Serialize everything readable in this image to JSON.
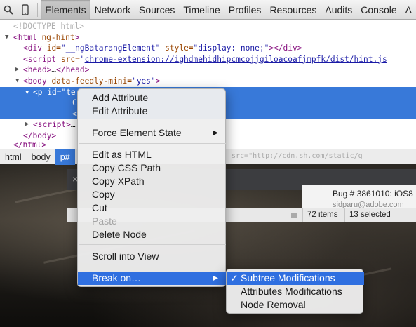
{
  "toolbar": {
    "tabs": [
      {
        "label": "Elements",
        "active": true
      },
      {
        "label": "Network"
      },
      {
        "label": "Sources"
      },
      {
        "label": "Timeline"
      },
      {
        "label": "Profiles"
      },
      {
        "label": "Resources"
      },
      {
        "label": "Audits"
      },
      {
        "label": "Console"
      },
      {
        "label": "A"
      }
    ]
  },
  "tree": {
    "doctype": "<!DOCTYPE html>",
    "html_open": {
      "tag": "<html",
      "attr": "ng-hint",
      "close": ">"
    },
    "div": {
      "tag": "<div",
      "attr1": "id=",
      "val1": "\"__ngBatarangElement\"",
      "attr2": "style=",
      "val2": "\"display: none;\"",
      "close": "></div>"
    },
    "script_src": {
      "tag": "<script",
      "attr": "src=",
      "val": "\"",
      "link": "chrome-extension://ighdmehidhipcmcojjgiloacoafjmpfk/dist/hint.js"
    },
    "head": {
      "tag": "<head>",
      "mid": "…",
      "close": "</head>"
    },
    "body_open": {
      "tag": "<body",
      "attr": "data-feedly-mini=",
      "val": "\"yes\"",
      "close": ">"
    },
    "p_open": {
      "tag": "<p",
      "attr": "id=",
      "val": "\"te"
    },
    "sel_line2": "C",
    "sel_line3": "<",
    "script_collapsed": {
      "tag": "<script>",
      "mid": "…"
    },
    "body_close": "</body>",
    "html_close": "</html>"
  },
  "breadcrumb": {
    "items": [
      "html",
      "body",
      "p#"
    ],
    "faded_text": "src=\"http://cdn.sh.com/static/g"
  },
  "page_behind": {
    "close_glyph": "×",
    "bug_title": "Bug # 3861010: iOS8",
    "bug_sub": "sidparu@adobe.com",
    "items_count": "72 items",
    "selected_count": "13 selected"
  },
  "context_menu": {
    "items": [
      {
        "label": "Add Attribute"
      },
      {
        "label": "Edit Attribute"
      },
      {
        "label": "Force Element State",
        "submenu": true
      },
      {
        "label": "Edit as HTML"
      },
      {
        "label": "Copy CSS Path"
      },
      {
        "label": "Copy XPath"
      },
      {
        "label": "Copy"
      },
      {
        "label": "Cut"
      },
      {
        "label": "Paste",
        "disabled": true
      },
      {
        "label": "Delete Node"
      },
      {
        "label": "Scroll into View"
      },
      {
        "label": "Break on…",
        "submenu": true,
        "highlighted": true
      }
    ],
    "arrow_glyph": "▶"
  },
  "submenu": {
    "check_glyph": "✓",
    "items": [
      {
        "label": "Subtree Modifications",
        "checked": true,
        "highlighted": true
      },
      {
        "label": "Attributes Modifications"
      },
      {
        "label": "Node Removal"
      }
    ]
  },
  "colors": {
    "selection": "#3879d9",
    "menu_highlight": "#2f6fe0",
    "tag": "#881280",
    "attr": "#994500",
    "value": "#1a1aa6"
  },
  "icons": [
    "search-icon",
    "device-icon",
    "expand-triangle-icon",
    "collapse-triangle-icon",
    "submenu-arrow-icon",
    "checkmark-icon",
    "close-icon"
  ]
}
